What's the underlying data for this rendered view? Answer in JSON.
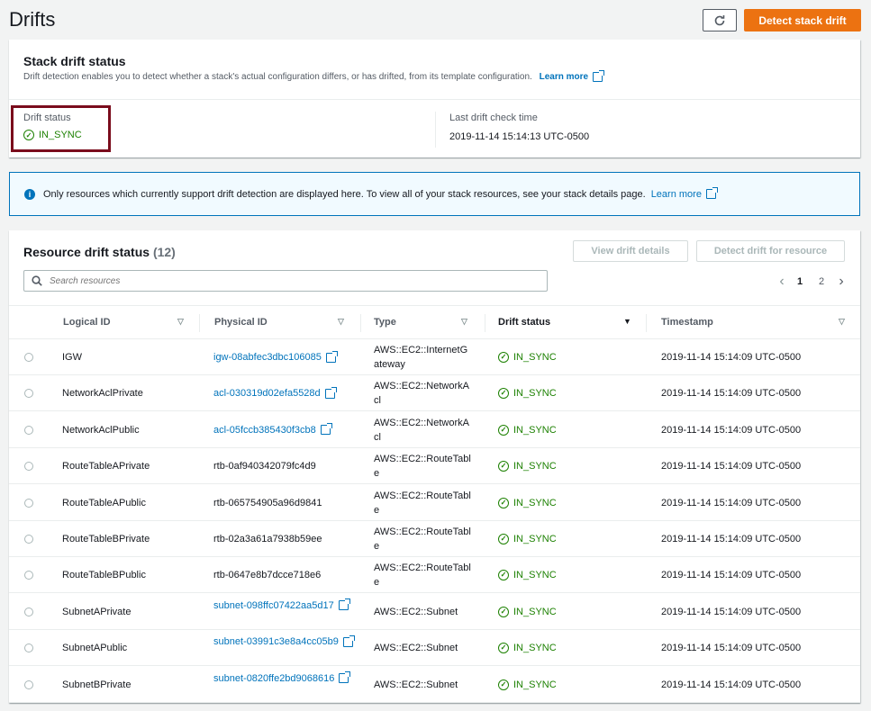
{
  "header": {
    "title": "Drifts",
    "detect_label": "Detect stack drift",
    "refresh_icon": "refresh-icon"
  },
  "stack_status": {
    "title": "Stack drift status",
    "description": "Drift detection enables you to detect whether a stack's actual configuration differs, or has drifted, from its template configuration.",
    "learn_more": "Learn more",
    "drift_status_label": "Drift status",
    "drift_status_value": "IN_SYNC",
    "last_check_label": "Last drift check time",
    "last_check_value": "2019-11-14 15:14:13 UTC-0500"
  },
  "info": {
    "text": "Only resources which currently support drift detection are displayed here. To view all of your stack resources, see your stack details page.",
    "learn_more": "Learn more"
  },
  "resources": {
    "title": "Resource drift status",
    "count": "(12)",
    "view_details_label": "View drift details",
    "detect_resource_label": "Detect drift for resource",
    "search_placeholder": "Search resources",
    "pages": [
      "1",
      "2"
    ],
    "columns": [
      "Logical ID",
      "Physical ID",
      "Type",
      "Drift status",
      "Timestamp"
    ],
    "rows": [
      {
        "logical": "IGW",
        "physical": "igw-08abfec3dbc106085",
        "link": true,
        "type": "AWS::EC2::InternetGateway",
        "status": "IN_SYNC",
        "timestamp": "2019-11-14 15:14:09 UTC-0500"
      },
      {
        "logical": "NetworkAclPrivate",
        "physical": "acl-030319d02efa5528d",
        "link": true,
        "type": "AWS::EC2::NetworkAcl",
        "status": "IN_SYNC",
        "timestamp": "2019-11-14 15:14:09 UTC-0500"
      },
      {
        "logical": "NetworkAclPublic",
        "physical": "acl-05fccb385430f3cb8",
        "link": true,
        "type": "AWS::EC2::NetworkAcl",
        "status": "IN_SYNC",
        "timestamp": "2019-11-14 15:14:09 UTC-0500"
      },
      {
        "logical": "RouteTableAPrivate",
        "physical": "rtb-0af940342079fc4d9",
        "link": false,
        "type": "AWS::EC2::RouteTable",
        "status": "IN_SYNC",
        "timestamp": "2019-11-14 15:14:09 UTC-0500"
      },
      {
        "logical": "RouteTableAPublic",
        "physical": "rtb-065754905a96d9841",
        "link": false,
        "type": "AWS::EC2::RouteTable",
        "status": "IN_SYNC",
        "timestamp": "2019-11-14 15:14:09 UTC-0500"
      },
      {
        "logical": "RouteTableBPrivate",
        "physical": "rtb-02a3a61a7938b59ee",
        "link": false,
        "type": "AWS::EC2::RouteTable",
        "status": "IN_SYNC",
        "timestamp": "2019-11-14 15:14:09 UTC-0500"
      },
      {
        "logical": "RouteTableBPublic",
        "physical": "rtb-0647e8b7dcce718e6",
        "link": false,
        "type": "AWS::EC2::RouteTable",
        "status": "IN_SYNC",
        "timestamp": "2019-11-14 15:14:09 UTC-0500"
      },
      {
        "logical": "SubnetAPrivate",
        "physical": "subnet-098ffc07422aa5d17",
        "link": true,
        "type": "AWS::EC2::Subnet",
        "status": "IN_SYNC",
        "timestamp": "2019-11-14 15:14:09 UTC-0500"
      },
      {
        "logical": "SubnetAPublic",
        "physical": "subnet-03991c3e8a4cc05b9",
        "link": true,
        "type": "AWS::EC2::Subnet",
        "status": "IN_SYNC",
        "timestamp": "2019-11-14 15:14:09 UTC-0500"
      },
      {
        "logical": "SubnetBPrivate",
        "physical": "subnet-0820ffe2bd9068616",
        "link": true,
        "type": "AWS::EC2::Subnet",
        "status": "IN_SYNC",
        "timestamp": "2019-11-14 15:14:09 UTC-0500"
      }
    ]
  },
  "colors": {
    "accent": "#ec7211",
    "link": "#0073bb",
    "success": "#1d8102",
    "highlight": "#7a0c1c"
  }
}
